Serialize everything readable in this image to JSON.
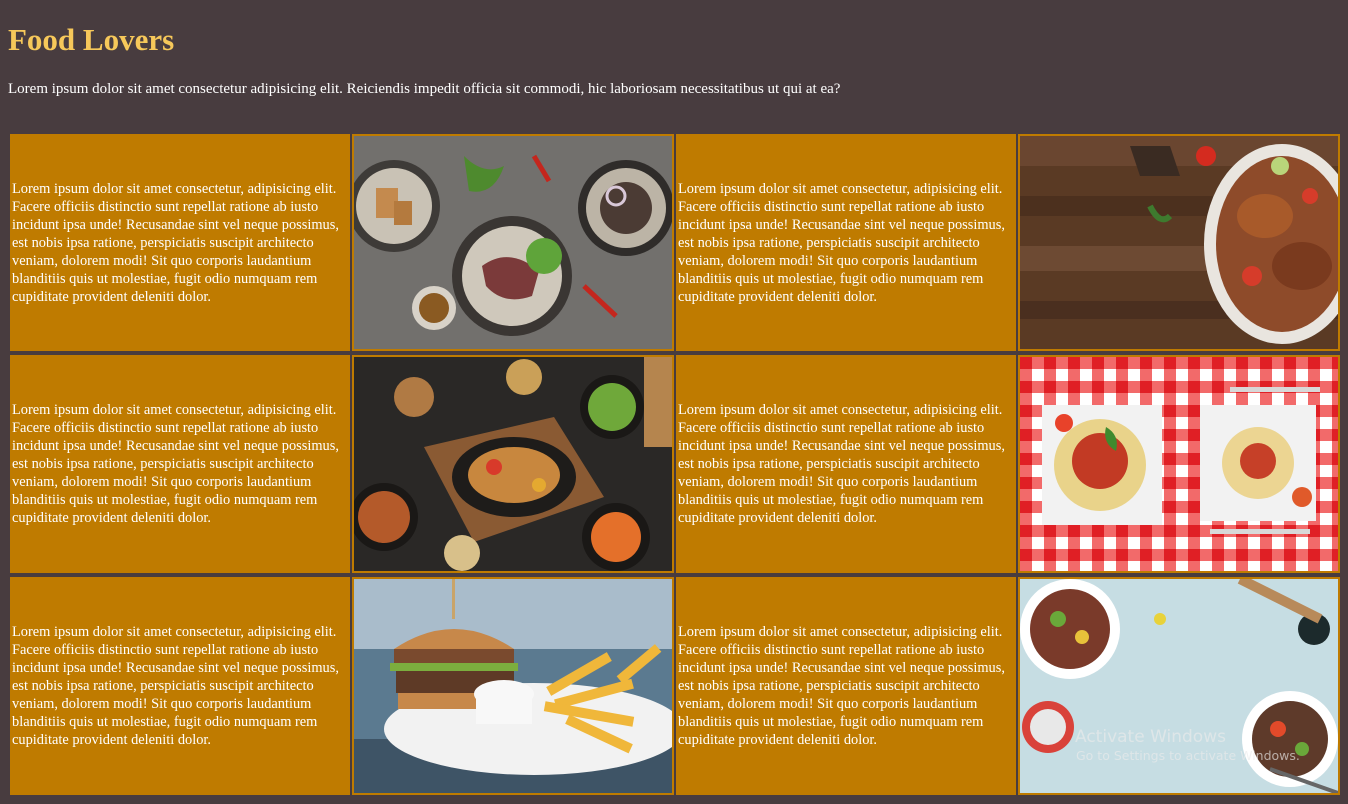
{
  "page": {
    "title": "Food Lovers",
    "intro": "Lorem ipsum dolor sit amet consectetur adipisicing elit. Reiciendis impedit officia sit commodi, hic laboriosam necessitatibus ut qui at ea?"
  },
  "grid": {
    "cell_text": "Lorem ipsum dolor sit amet consectetur, adipisicing elit. Facere officiis distinctio sunt repellat ratione ab iusto incidunt ipsa unde! Recusandae sint vel neque possimus, est nobis ipsa ratione, perspiciatis suscipit architecto veniam, dolorem modi! Sit quo corporis laudantium blanditiis quis ut molestiae, fugit odio numquam rem cupiditate provident deleniti dolor.",
    "rows": [
      {
        "text_1": "Lorem ipsum dolor sit amet consectetur, adipisicing elit. Facere officiis distinctio sunt repellat ratione ab iusto incidunt ipsa unde! Recusandae sint vel neque possimus, est nobis ipsa ratione, perspiciatis suscipit architecto veniam, dolorem modi! Sit quo corporis laudantium blanditiis quis ut molestiae, fugit odio numquam rem cupiditate provident deleniti dolor.",
        "image_1": "plated-dishes-photo",
        "text_2": "Lorem ipsum dolor sit amet consectetur, adipisicing elit. Facere officiis distinctio sunt repellat ratione ab iusto incidunt ipsa unde! Recusandae sint vel neque possimus, est nobis ipsa ratione, perspiciatis suscipit architecto veniam, dolorem modi! Sit quo corporis laudantium blanditiis quis ut molestiae, fugit odio numquam rem cupiditate provident deleniti dolor.",
        "image_2": "grilled-chicken-photo"
      },
      {
        "text_1": "Lorem ipsum dolor sit amet consectetur, adipisicing elit. Facere officiis distinctio sunt repellat ratione ab iusto incidunt ipsa unde! Recusandae sint vel neque possimus, est nobis ipsa ratione, perspiciatis suscipit architecto veniam, dolorem modi! Sit quo corporis laudantium blanditiis quis ut molestiae, fugit odio numquam rem cupiditate provident deleniti dolor.",
        "image_1": "roast-feast-photo",
        "text_2": "Lorem ipsum dolor sit amet consectetur, adipisicing elit. Facere officiis distinctio sunt repellat ratione ab iusto incidunt ipsa unde! Recusandae sint vel neque possimus, est nobis ipsa ratione, perspiciatis suscipit architecto veniam, dolorem modi! Sit quo corporis laudantium blanditiis quis ut molestiae, fugit odio numquam rem cupiditate provident deleniti dolor.",
        "image_2": "spaghetti-checkered-photo"
      },
      {
        "text_1": "Lorem ipsum dolor sit amet consectetur, adipisicing elit. Facere officiis distinctio sunt repellat ratione ab iusto incidunt ipsa unde! Recusandae sint vel neque possimus, est nobis ipsa ratione, perspiciatis suscipit architecto veniam, dolorem modi! Sit quo corporis laudantium blanditiis quis ut molestiae, fugit odio numquam rem cupiditate provident deleniti dolor.",
        "image_1": "burger-fries-photo",
        "text_2": "Lorem ipsum dolor sit amet consectetur, adipisicing elit. Facere officiis distinctio sunt repellat ratione ab iusto incidunt ipsa unde! Recusandae sint vel neque possimus, est nobis ipsa ratione, perspiciatis suscipit architecto veniam, dolorem modi! Sit quo corporis laudantium blanditiis quis ut molestiae, fugit odio numquam rem cupiditate provident deleniti dolor.",
        "image_2": "salad-bowls-photo"
      }
    ]
  },
  "watermark": {
    "line1": "Activate Windows",
    "line2": "Go to Settings to activate Windows."
  },
  "colors": {
    "background": "#483c3f",
    "title": "#f6c85a",
    "cell": "#bf7b00"
  }
}
